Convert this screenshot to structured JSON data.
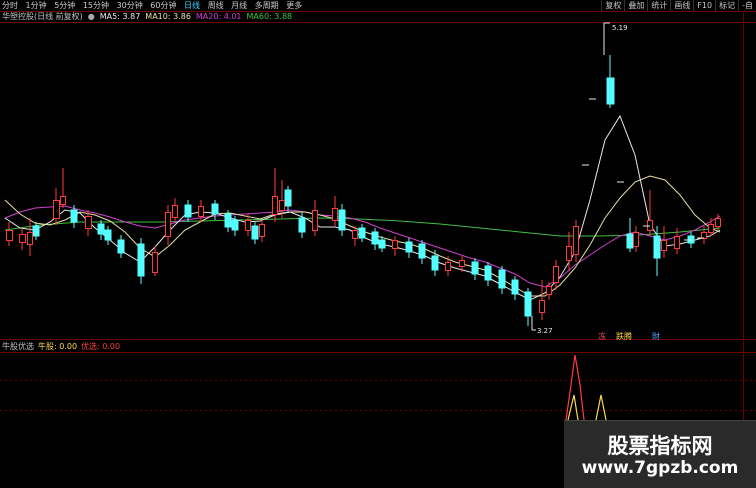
{
  "toolbar": {
    "periods": [
      "分时",
      "1分钟",
      "5分钟",
      "15分钟",
      "30分钟",
      "60分钟",
      "日线",
      "周线",
      "月线",
      "多周期",
      "更多"
    ],
    "active_period": "日线",
    "right_buttons": [
      "复权",
      "叠加",
      "统计",
      "画线",
      "F10",
      "标记",
      "-自"
    ]
  },
  "info": {
    "title": "华塑控股(日线 前复权)",
    "ma5": "MA5: 3.87",
    "ma10": "MA10: 3.86",
    "ma20": "MA20: 4.01",
    "ma60": "MA60: 3.88"
  },
  "indicator": {
    "name": "牛股优选",
    "a": "牛股: 0.00",
    "b": "优选: 0.00"
  },
  "annotations": {
    "high": "5.19",
    "low": "3.27",
    "marker_1": "冻",
    "marker_2": "跌腾",
    "marker_3": "財"
  },
  "watermark": {
    "title": "股票指标网",
    "url": "www.7gpzb.com"
  },
  "colors": {
    "up": "#ff3c3c",
    "down": "#54ffff",
    "ma5": "#e8e8e8",
    "ma10": "#e8e0a0",
    "ma20": "#d040d0",
    "ma60": "#40c040",
    "active": "#3cd7ff"
  }
}
